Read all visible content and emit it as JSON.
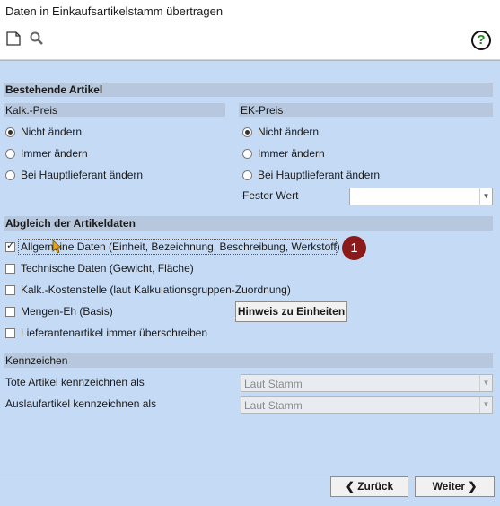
{
  "window": {
    "title": "Daten in Einkaufsartikelstamm übertragen"
  },
  "toolbar": {
    "new_icon": "new-document-icon",
    "search_icon": "search-icon",
    "help_label": "?"
  },
  "bestehende": {
    "title": "Bestehende Artikel",
    "kalk": {
      "title": "Kalk.-Preis",
      "options": [
        "Nicht ändern",
        "Immer ändern",
        "Bei Hauptlieferant ändern"
      ],
      "selected": 0
    },
    "ek": {
      "title": "EK-Preis",
      "options": [
        "Nicht ändern",
        "Immer ändern",
        "Bei Hauptlieferant ändern"
      ],
      "selected": 0,
      "fixed_label": "Fester Wert",
      "fixed_value": ""
    }
  },
  "abgleich": {
    "title": "Abgleich der Artikeldaten",
    "items": [
      {
        "label": "Allgemeine Daten (Einheit, Bezeichnung, Beschreibung, Werkstoff)",
        "checked": true
      },
      {
        "label": "Technische Daten (Gewicht, Fläche)",
        "checked": false
      },
      {
        "label": "Kalk.-Kostenstelle (laut Kalkulationsgruppen-Zuordnung)",
        "checked": false
      },
      {
        "label": "Mengen-Eh (Basis)",
        "checked": false
      },
      {
        "label": "Lieferantenartikel immer überschreiben",
        "checked": false
      }
    ],
    "hint_button": "Hinweis zu Einheiten",
    "annotation": "1"
  },
  "kennzeichen": {
    "title": "Kennzeichen",
    "tote_label": "Tote Artikel kennzeichnen als",
    "tote_value": "Laut Stamm",
    "auslauf_label": "Auslaufartikel kennzeichnen als",
    "auslauf_value": "Laut Stamm"
  },
  "footer": {
    "back": "Zurück",
    "next": "Weiter"
  }
}
